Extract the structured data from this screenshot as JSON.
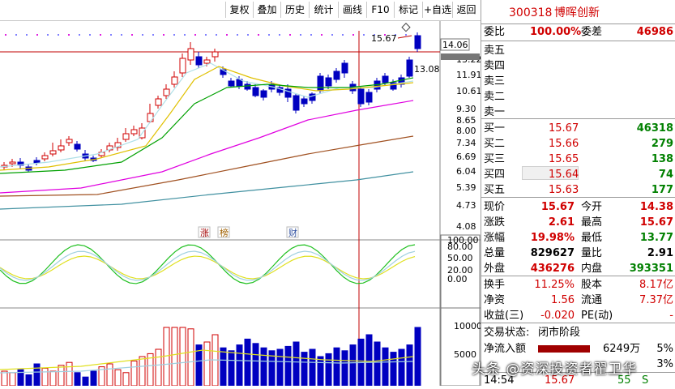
{
  "toolbar": {
    "buttons": [
      "复权",
      "叠加",
      "历史",
      "统计",
      "画线",
      "F10",
      "标记",
      "+自选",
      "返回"
    ]
  },
  "chart": {
    "price_labels": [
      "14.06",
      "13.22",
      "11.91",
      "10.61",
      "9.30",
      "8.65",
      "8.00",
      "7.34",
      "6.69",
      "6.04",
      "5.39",
      "4.73",
      "4.08"
    ],
    "high_label": "15.67",
    "low_label": "13.08",
    "badges": [
      "涨",
      "榜",
      "财"
    ],
    "macd_labels": [
      "100.00",
      "80.00",
      "50.00",
      "20.00",
      "0.00"
    ],
    "vol_labels": [
      "10000",
      "5000"
    ],
    "colors": {
      "up": "#d00000",
      "down": "#0000c0",
      "ma5": "#b0e0e8",
      "ma10": "#e0c000",
      "ma20": "#00a000",
      "ma60": "#e000e0",
      "ma120": "#a05020",
      "ma250": "#4090a0"
    }
  },
  "panel": {
    "code": "300318",
    "name": "博晖创新",
    "weibi_label": "委比",
    "weibi_value": "100.00%",
    "weicha_label": "委差",
    "weicha_value": "46986",
    "asks": [
      {
        "label": "卖五",
        "price": "",
        "vol": ""
      },
      {
        "label": "卖四",
        "price": "",
        "vol": ""
      },
      {
        "label": "卖三",
        "price": "",
        "vol": ""
      },
      {
        "label": "卖二",
        "price": "",
        "vol": ""
      },
      {
        "label": "卖一",
        "price": "",
        "vol": ""
      }
    ],
    "bids": [
      {
        "label": "买一",
        "price": "15.67",
        "vol": "46318"
      },
      {
        "label": "买二",
        "price": "15.66",
        "vol": "279"
      },
      {
        "label": "买三",
        "price": "15.65",
        "vol": "138"
      },
      {
        "label": "买四",
        "price": "15.64",
        "vol": "74"
      },
      {
        "label": "买五",
        "price": "15.63",
        "vol": "177"
      }
    ],
    "stats": [
      {
        "l1": "现价",
        "v1": "15.67",
        "l2": "今开",
        "v2": "14.38"
      },
      {
        "l1": "涨跌",
        "v1": "2.61",
        "l2": "最高",
        "v2": "15.67"
      },
      {
        "l1": "涨幅",
        "v1": "19.98%",
        "l2": "最低",
        "v2": "13.77"
      },
      {
        "l1": "总量",
        "v1": "829627",
        "l2": "量比",
        "v2": "2.91"
      },
      {
        "l1": "外盘",
        "v1": "436276",
        "l2": "内盘",
        "v2": "393351"
      }
    ],
    "stats2": [
      {
        "l1": "换手",
        "v1": "11.25%",
        "l2": "股本",
        "v2": "8.17亿"
      },
      {
        "l1": "净资",
        "v1": "1.56",
        "l2": "流通",
        "v2": "7.37亿"
      },
      {
        "l1": "收益(三)",
        "v1": "-0.020",
        "l2": "PE(动)",
        "v2": "-"
      }
    ],
    "status_label": "交易状态:",
    "status_value": "闭市阶段",
    "netflow_label": "净流入额",
    "netflow_value": "6249万",
    "netflow_pct": "5%",
    "row2_value": "3%",
    "tick_time": "14:54",
    "tick_price": "15.67",
    "tick_vol": "55",
    "tick_flag": "S"
  },
  "watermark": "头条 @资深投资者翟卫华"
}
